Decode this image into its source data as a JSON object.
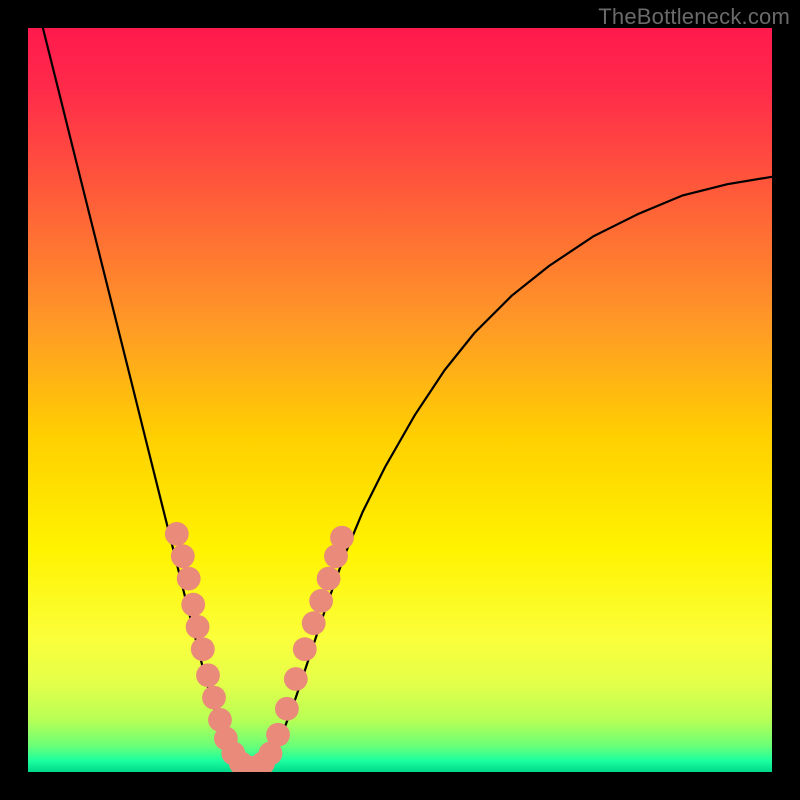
{
  "attribution": "TheBottleneck.com",
  "gradient_stops": [
    {
      "offset": 0,
      "color": "#ff1a4d"
    },
    {
      "offset": 0.08,
      "color": "#ff2a4a"
    },
    {
      "offset": 0.22,
      "color": "#ff5a3a"
    },
    {
      "offset": 0.4,
      "color": "#ff9a26"
    },
    {
      "offset": 0.55,
      "color": "#ffd000"
    },
    {
      "offset": 0.7,
      "color": "#fff300"
    },
    {
      "offset": 0.82,
      "color": "#fbff3a"
    },
    {
      "offset": 0.88,
      "color": "#e4ff4a"
    },
    {
      "offset": 0.93,
      "color": "#b8ff55"
    },
    {
      "offset": 0.965,
      "color": "#6aff78"
    },
    {
      "offset": 0.985,
      "color": "#1bff9f"
    },
    {
      "offset": 1.0,
      "color": "#00d88a"
    }
  ],
  "chart_data": {
    "type": "line",
    "title": "",
    "xlabel": "",
    "ylabel": "",
    "xlim": [
      0,
      100
    ],
    "ylim": [
      0,
      100
    ],
    "series": [
      {
        "name": "bottleneck-curve",
        "x": [
          2,
          4,
          6,
          8,
          10,
          12,
          14,
          16,
          18,
          19.5,
          21,
          22.5,
          24,
          25.5,
          27,
          28.5,
          30,
          31.5,
          33,
          34.5,
          36,
          38,
          40,
          42.5,
          45,
          48,
          52,
          56,
          60,
          65,
          70,
          76,
          82,
          88,
          94,
          100
        ],
        "y": [
          100,
          92,
          84,
          76,
          68,
          60,
          52,
          44,
          36,
          30,
          24,
          18,
          12,
          7,
          3,
          1,
          0,
          1,
          3,
          6,
          10,
          16,
          22,
          29,
          35,
          41,
          48,
          54,
          59,
          64,
          68,
          72,
          75,
          77.5,
          79,
          80
        ]
      }
    ],
    "markers": {
      "name": "highlight-dots",
      "color": "#e98a7a",
      "points": [
        {
          "x": 20.0,
          "y": 32.0,
          "r": 1.6
        },
        {
          "x": 20.8,
          "y": 29.0,
          "r": 1.6
        },
        {
          "x": 21.6,
          "y": 26.0,
          "r": 1.6
        },
        {
          "x": 22.2,
          "y": 22.5,
          "r": 1.6
        },
        {
          "x": 22.8,
          "y": 19.5,
          "r": 1.6
        },
        {
          "x": 23.5,
          "y": 16.5,
          "r": 1.6
        },
        {
          "x": 24.2,
          "y": 13.0,
          "r": 1.6
        },
        {
          "x": 25.0,
          "y": 10.0,
          "r": 1.6
        },
        {
          "x": 25.8,
          "y": 7.0,
          "r": 1.6
        },
        {
          "x": 26.6,
          "y": 4.5,
          "r": 1.6
        },
        {
          "x": 27.6,
          "y": 2.5,
          "r": 1.6
        },
        {
          "x": 28.6,
          "y": 1.2,
          "r": 1.6
        },
        {
          "x": 29.6,
          "y": 0.6,
          "r": 1.6
        },
        {
          "x": 30.6,
          "y": 0.6,
          "r": 1.6
        },
        {
          "x": 31.6,
          "y": 1.2,
          "r": 1.6
        },
        {
          "x": 32.6,
          "y": 2.5,
          "r": 1.6
        },
        {
          "x": 33.6,
          "y": 5.0,
          "r": 1.6
        },
        {
          "x": 34.8,
          "y": 8.5,
          "r": 1.6
        },
        {
          "x": 36.0,
          "y": 12.5,
          "r": 1.6
        },
        {
          "x": 37.2,
          "y": 16.5,
          "r": 1.6
        },
        {
          "x": 38.4,
          "y": 20.0,
          "r": 1.6
        },
        {
          "x": 39.4,
          "y": 23.0,
          "r": 1.6
        },
        {
          "x": 40.4,
          "y": 26.0,
          "r": 1.6
        },
        {
          "x": 41.4,
          "y": 29.0,
          "r": 1.6
        },
        {
          "x": 42.2,
          "y": 31.5,
          "r": 1.6
        }
      ]
    }
  }
}
